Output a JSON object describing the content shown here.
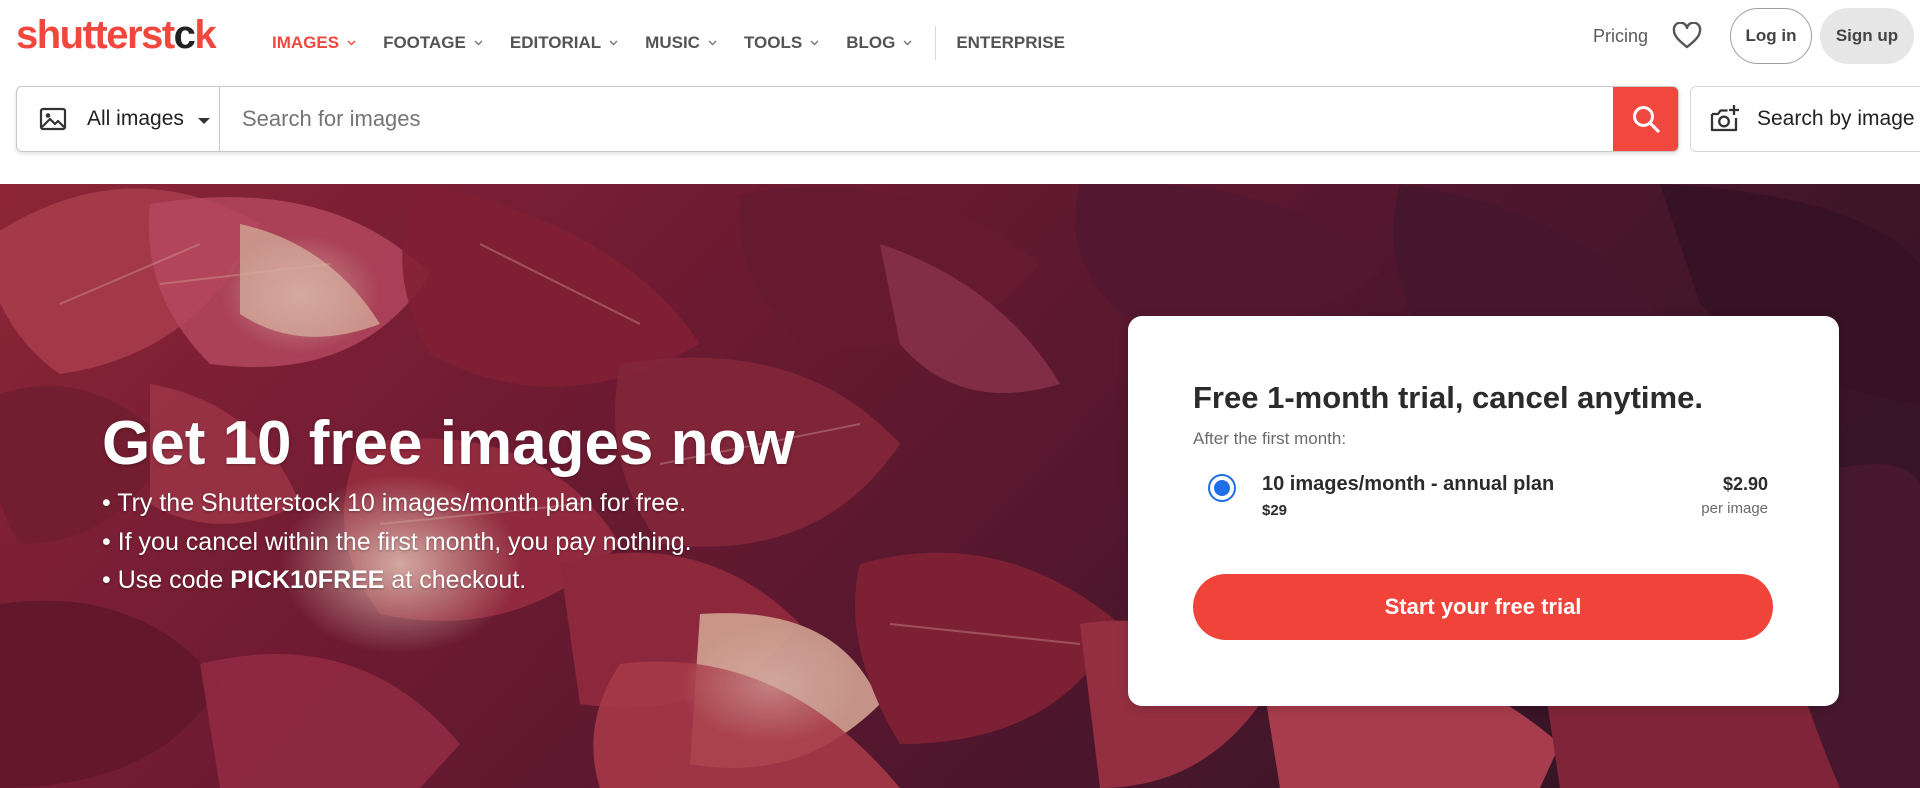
{
  "logo": {
    "part1": "shutterst",
    "part2": "c",
    "part3": "k"
  },
  "nav": {
    "items": [
      {
        "label": "IMAGES",
        "dropdown": true,
        "active": true
      },
      {
        "label": "FOOTAGE",
        "dropdown": true
      },
      {
        "label": "EDITORIAL",
        "dropdown": true
      },
      {
        "label": "MUSIC",
        "dropdown": true
      },
      {
        "label": "TOOLS",
        "dropdown": true
      },
      {
        "label": "BLOG",
        "dropdown": true
      }
    ],
    "enterprise": "ENTERPRISE",
    "pricing": "Pricing",
    "favorites_icon": "heart-icon",
    "login": "Log in",
    "signup": "Sign up"
  },
  "search": {
    "type_icon": "image-icon",
    "type_label": "All images",
    "placeholder": "Search for images",
    "value": "",
    "submit_icon": "search-icon",
    "by_image_icon": "camera-plus-icon",
    "by_image_label": "Search by image"
  },
  "hero": {
    "title": "Get 10 free images now",
    "bullets": {
      "b1": "• Try the Shutterstock 10 images/month plan for free.",
      "b2": "• If you cancel within the first month, you pay nothing.",
      "b3_pre": "• Use code ",
      "b3_code": "PICK10FREE",
      "b3_post": " at checkout."
    }
  },
  "offer": {
    "title": "Free 1-month trial, cancel anytime.",
    "subtitle": "After the first month:",
    "plan": {
      "selected": true,
      "name": "10 images/month - annual plan",
      "price_total": "$29",
      "price_per": "$2.90",
      "unit": "per image"
    },
    "cta": "Start your free trial"
  },
  "colors": {
    "brand": "#f0483e",
    "radio": "#1e6ee8",
    "nav_text": "#545454"
  }
}
